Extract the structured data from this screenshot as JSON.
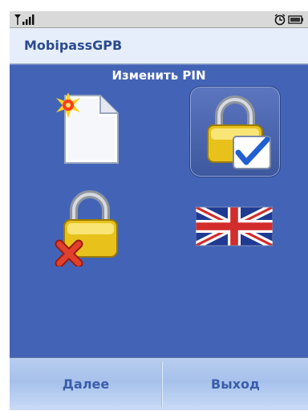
{
  "app": {
    "title": "MobipassGPB"
  },
  "screen": {
    "title": "Изменить PIN"
  },
  "menu": {
    "items": [
      {
        "icon": "new-document-icon",
        "selected": false
      },
      {
        "icon": "padlock-check-icon",
        "selected": true
      },
      {
        "icon": "padlock-delete-icon",
        "selected": false
      },
      {
        "icon": "uk-flag-icon",
        "selected": false
      }
    ]
  },
  "softkeys": {
    "left": "Далее",
    "right": "Выход"
  },
  "colors": {
    "main_background": "#4364b6",
    "titlebar_background": "#e6eefc",
    "softkey_text": "#3b5da8",
    "selection": "#5b76bf"
  }
}
